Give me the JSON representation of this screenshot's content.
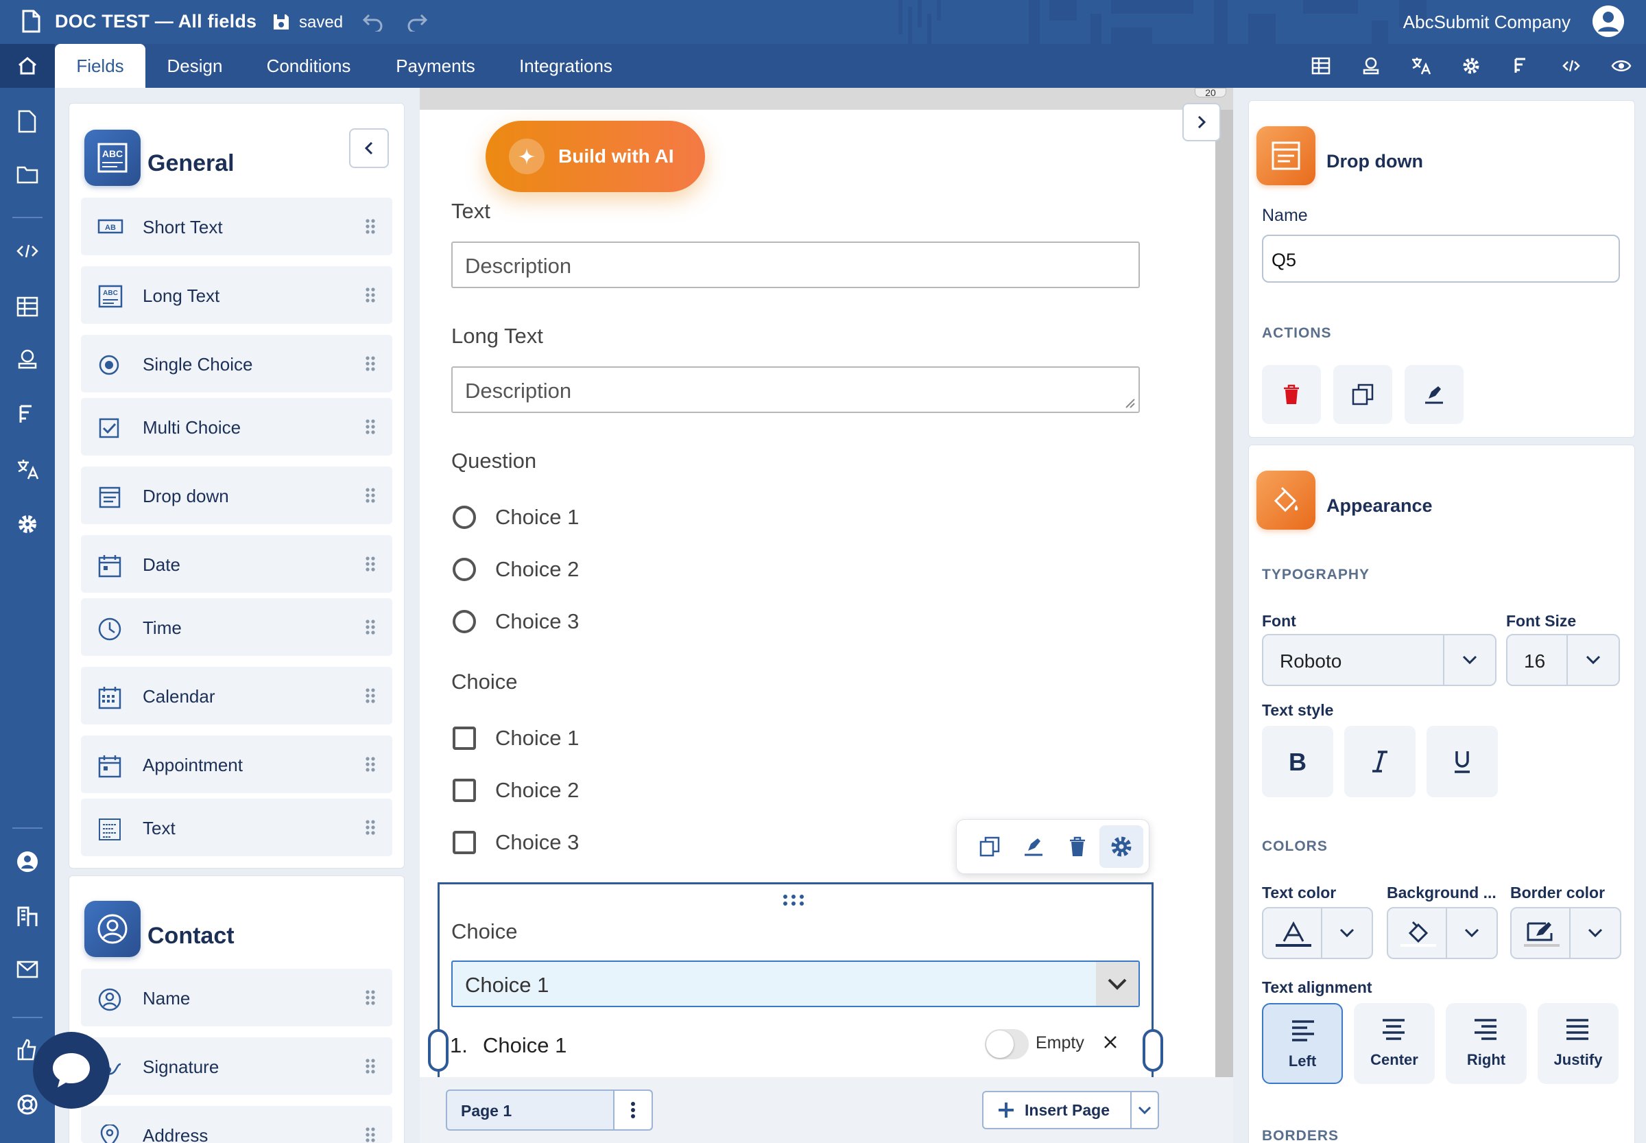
{
  "topbar": {
    "title": "DOC TEST — All fields",
    "saved": "saved",
    "company": "AbcSubmit Company"
  },
  "nav": {
    "tabs": [
      "Fields",
      "Design",
      "Conditions",
      "Payments",
      "Integrations"
    ],
    "active_tab": "Fields"
  },
  "left_panel": {
    "general": {
      "title": "General",
      "fields": [
        {
          "label": "Short Text",
          "icon": "short-text-icon"
        },
        {
          "label": "Long Text",
          "icon": "long-text-icon"
        },
        {
          "label": "Single Choice",
          "icon": "radio-icon"
        },
        {
          "label": "Multi Choice",
          "icon": "checkbox-icon"
        },
        {
          "label": "Drop down",
          "icon": "dropdown-icon"
        },
        {
          "label": "Date",
          "icon": "date-icon"
        },
        {
          "label": "Time",
          "icon": "clock-icon"
        },
        {
          "label": "Calendar",
          "icon": "calendar-icon"
        },
        {
          "label": "Appointment",
          "icon": "appointment-icon"
        },
        {
          "label": "Text",
          "icon": "text-block-icon"
        }
      ]
    },
    "contact": {
      "title": "Contact",
      "fields": [
        {
          "label": "Name",
          "icon": "person-icon"
        },
        {
          "label": "Signature",
          "icon": "signature-icon"
        },
        {
          "label": "Address",
          "icon": "location-pin-icon"
        }
      ]
    }
  },
  "canvas": {
    "ruler": "20",
    "ai_button": "Build with AI",
    "text_field": {
      "label": "Text",
      "placeholder": "Description"
    },
    "long_text_field": {
      "label": "Long Text",
      "placeholder": "Description"
    },
    "question": {
      "label": "Question",
      "options": [
        "Choice 1",
        "Choice 2",
        "Choice 3"
      ]
    },
    "choice_checkbox": {
      "label": "Choice",
      "options": [
        "Choice 1",
        "Choice 2",
        "Choice 3"
      ]
    },
    "dropdown_field": {
      "label": "Choice",
      "selected": "Choice 1",
      "items": [
        {
          "num": "1.",
          "label": "Choice 1",
          "toggle_label": "Empty"
        }
      ]
    },
    "page_label": "Page 1",
    "insert_page": "Insert Page"
  },
  "right_panel": {
    "element_title": "Drop down",
    "name_label": "Name",
    "name_value": "Q5",
    "actions_title": "ACTIONS",
    "appearance_title": "Appearance",
    "typography_title": "TYPOGRAPHY",
    "font_label": "Font",
    "font_value": "Roboto",
    "font_size_label": "Font Size",
    "font_size_value": "16",
    "text_style_label": "Text style",
    "colors_title": "COLORS",
    "text_color_label": "Text color",
    "background_label": "Background ...",
    "border_color_label": "Border color",
    "text_alignment_label": "Text alignment",
    "alignments": [
      "Left",
      "Center",
      "Right",
      "Justify"
    ],
    "alignment_selected": "Left",
    "borders_title": "BORDERS"
  },
  "colors": {
    "primary": "#2e5a98",
    "nav_dark": "#1e3f73",
    "accent_orange": "#ec8a12",
    "delete_red": "#d9121b"
  }
}
